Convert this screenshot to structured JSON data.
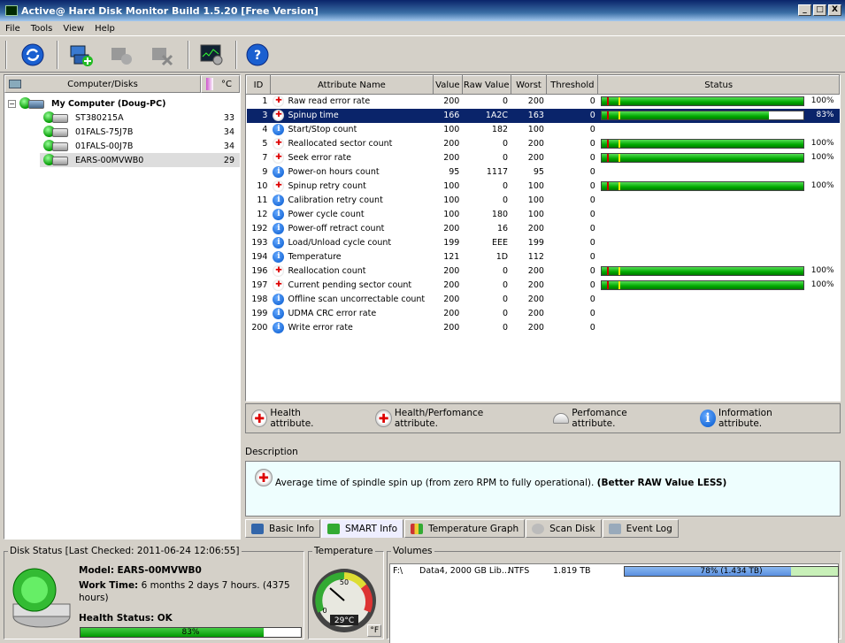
{
  "window": {
    "title": "Active@ Hard Disk Monitor Build 1.5.20 [Free Version]",
    "min": "_",
    "max": "□",
    "close": "X"
  },
  "menu": [
    "File",
    "Tools",
    "View",
    "Help"
  ],
  "tree": {
    "header": "Computer/Disks",
    "temp_header": "°C",
    "root": "My Computer (Doug-PC)",
    "disks": [
      {
        "name": "ST380215A",
        "temp": "33"
      },
      {
        "name": "01FALS-75J7B",
        "temp": "34"
      },
      {
        "name": "01FALS-00J7B",
        "temp": "34"
      },
      {
        "name": "EARS-00MVWB0",
        "temp": "29"
      }
    ]
  },
  "smart": {
    "headers": [
      "ID",
      "Attribute Name",
      "Value",
      "Raw Value",
      "Worst",
      "Threshold",
      "Status"
    ],
    "rows": [
      {
        "id": "1",
        "name": "Raw read error rate",
        "icon": "health",
        "value": "200",
        "raw": "0",
        "worst": "200",
        "thr": "0",
        "pct": "100%",
        "fill": 100
      },
      {
        "id": "3",
        "name": "Spinup time",
        "icon": "health-perf",
        "value": "166",
        "raw": "1A2C",
        "worst": "163",
        "thr": "0",
        "pct": "83%",
        "fill": 83
      },
      {
        "id": "4",
        "name": "Start/Stop count",
        "icon": "info",
        "value": "100",
        "raw": "182",
        "worst": "100",
        "thr": "0",
        "pct": "",
        "fill": 0
      },
      {
        "id": "5",
        "name": "Reallocated sector count",
        "icon": "health",
        "value": "200",
        "raw": "0",
        "worst": "200",
        "thr": "0",
        "pct": "100%",
        "fill": 100
      },
      {
        "id": "7",
        "name": "Seek error rate",
        "icon": "health",
        "value": "200",
        "raw": "0",
        "worst": "200",
        "thr": "0",
        "pct": "100%",
        "fill": 100
      },
      {
        "id": "9",
        "name": "Power-on hours count",
        "icon": "info",
        "value": "95",
        "raw": "1117",
        "worst": "95",
        "thr": "0",
        "pct": "",
        "fill": 0
      },
      {
        "id": "10",
        "name": "Spinup retry count",
        "icon": "health",
        "value": "100",
        "raw": "0",
        "worst": "100",
        "thr": "0",
        "pct": "100%",
        "fill": 100
      },
      {
        "id": "11",
        "name": "Calibration retry count",
        "icon": "info",
        "value": "100",
        "raw": "0",
        "worst": "100",
        "thr": "0",
        "pct": "",
        "fill": 0
      },
      {
        "id": "12",
        "name": "Power cycle count",
        "icon": "info",
        "value": "100",
        "raw": "180",
        "worst": "100",
        "thr": "0",
        "pct": "",
        "fill": 0
      },
      {
        "id": "192",
        "name": "Power-off retract count",
        "icon": "info",
        "value": "200",
        "raw": "16",
        "worst": "200",
        "thr": "0",
        "pct": "",
        "fill": 0
      },
      {
        "id": "193",
        "name": "Load/Unload cycle count",
        "icon": "info",
        "value": "199",
        "raw": "EEE",
        "worst": "199",
        "thr": "0",
        "pct": "",
        "fill": 0
      },
      {
        "id": "194",
        "name": "Temperature",
        "icon": "info",
        "value": "121",
        "raw": "1D",
        "worst": "112",
        "thr": "0",
        "pct": "",
        "fill": 0
      },
      {
        "id": "196",
        "name": "Reallocation count",
        "icon": "health",
        "value": "200",
        "raw": "0",
        "worst": "200",
        "thr": "0",
        "pct": "100%",
        "fill": 100
      },
      {
        "id": "197",
        "name": "Current pending sector count",
        "icon": "health",
        "value": "200",
        "raw": "0",
        "worst": "200",
        "thr": "0",
        "pct": "100%",
        "fill": 100
      },
      {
        "id": "198",
        "name": "Offline scan uncorrectable count",
        "icon": "info",
        "value": "200",
        "raw": "0",
        "worst": "200",
        "thr": "0",
        "pct": "",
        "fill": 0
      },
      {
        "id": "199",
        "name": "UDMA CRC error rate",
        "icon": "info",
        "value": "200",
        "raw": "0",
        "worst": "200",
        "thr": "0",
        "pct": "",
        "fill": 0
      },
      {
        "id": "200",
        "name": "Write error rate",
        "icon": "info",
        "value": "200",
        "raw": "0",
        "worst": "200",
        "thr": "0",
        "pct": "",
        "fill": 0
      }
    ]
  },
  "legend": [
    "Health attribute.",
    "Health/Perfomance attribute.",
    "Perfomance attribute.",
    "Information attribute."
  ],
  "description": {
    "label": "Description",
    "text": "Average time of spindle spin up (from zero RPM to fully operational). ",
    "bold": "(Better RAW Value LESS)"
  },
  "tabs": [
    "Basic Info",
    "SMART Info",
    "Temperature Graph",
    "Scan Disk",
    "Event Log"
  ],
  "status": {
    "legend": "Disk Status [Last Checked: 2011-06-24 12:06:55]",
    "model_label": "Model:",
    "model": "EARS-00MVWB0",
    "work_label": "Work Time:",
    "work": "6 months 2 days 7 hours. (4375 hours)",
    "health_label": "Health Status:",
    "health": "OK",
    "health_pct": "83%",
    "health_fill": 83
  },
  "temperature": {
    "legend": "Temperature",
    "value": "29°C",
    "unit": "°F",
    "tick_50": "50",
    "tick_0": "0"
  },
  "volumes": {
    "legend": "Volumes",
    "rows": [
      {
        "drive": "F:\\",
        "label": "Data4, 2000 GB Lib...",
        "fs": "NTFS",
        "size": "1.819 TB",
        "usage": "78% (1.434 TB)",
        "fill": 78
      }
    ]
  },
  "colors": {
    "select": "#0a246a",
    "bar_green": "#0a0",
    "desc_bg": "#eefefe"
  }
}
